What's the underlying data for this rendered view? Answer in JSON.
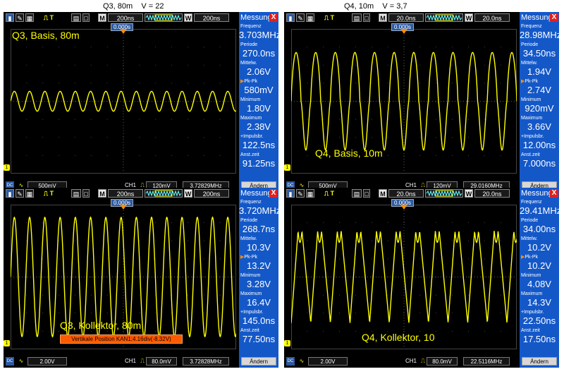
{
  "captions": [
    {
      "text": "Q3, 80m    V = 22"
    },
    {
      "text": "Q4, 10m    V = 3,7"
    }
  ],
  "colors": {
    "trace": "#ffff00",
    "panel": "#1458c8",
    "grid": "#5a5a5a",
    "warning": "#ff5a00"
  },
  "screens": [
    {
      "label": "Q3, Basis, 80m",
      "toolbar": {
        "run_stop": "⎍ T",
        "m": "M",
        "timebase": "200ns",
        "w": "W",
        "window": "200ns"
      },
      "time_marker": "0.000s",
      "panel": {
        "title": "Messung",
        "close": "X",
        "items": [
          {
            "label": "Frequenz",
            "value": "3.703MHz"
          },
          {
            "label": "Periode",
            "value": "270.0ns"
          },
          {
            "label": "Mittelw.",
            "value": "2.06V"
          },
          {
            "label": "Pk-Pk",
            "value": "580mV"
          },
          {
            "label": "Minimum",
            "value": "1.80V"
          },
          {
            "label": "Maximum",
            "value": "2.38V"
          },
          {
            "label": "+Impulsbr.",
            "value": "122.5ns"
          },
          {
            "label": "Anst.zeit",
            "value": "91.25ns"
          }
        ],
        "button": "Ändern"
      },
      "status": {
        "coupling": "DC",
        "volts": "500mV",
        "channel": "CH1",
        "trigger_level": "120mV",
        "freq": "3.72829MHz"
      },
      "trace": {
        "amplitude_divs": 0.55,
        "periods_per_screen": 14.8,
        "offset_divs": 0.0,
        "shape": "sine"
      }
    },
    {
      "label": "Q4, Basis, 10m",
      "toolbar": {
        "run_stop": "⎍ T",
        "m": "M",
        "timebase": "20.0ns",
        "w": "W",
        "window": "20.0ns"
      },
      "time_marker": "0.000s",
      "panel": {
        "title": "Messung",
        "close": "X",
        "items": [
          {
            "label": "Frequenz",
            "value": "28.98MHz"
          },
          {
            "label": "Periode",
            "value": "34.50ns"
          },
          {
            "label": "Mittelw.",
            "value": "1.94V"
          },
          {
            "label": "Pk-Pk",
            "value": "2.74V"
          },
          {
            "label": "Minimum",
            "value": "920mV"
          },
          {
            "label": "Maximum",
            "value": "3.66V"
          },
          {
            "label": "+Impulsbr.",
            "value": "12.00ns"
          },
          {
            "label": "Anst.zeit",
            "value": "7.000ns"
          }
        ],
        "button": "Ändern"
      },
      "status": {
        "coupling": "DC",
        "volts": "500mV",
        "channel": "CH1",
        "trigger_level": "120mV",
        "freq": "29.0160MHz"
      },
      "trace": {
        "amplitude_divs": 2.7,
        "periods_per_screen": 11.5,
        "offset_divs": 0.0,
        "shape": "rounded"
      }
    },
    {
      "label": "Q3, Kollektor, 80m",
      "toolbar": {
        "run_stop": "⎍ T",
        "m": "M",
        "timebase": "200ns",
        "w": "W",
        "window": "200ns"
      },
      "time_marker": "0.000s",
      "warning": "Vertikale  Position  KAN1:4.16div(-8.32V)",
      "panel": {
        "title": "Messung",
        "close": "X",
        "items": [
          {
            "label": "Frequenz",
            "value": "3.720MHz"
          },
          {
            "label": "Periode",
            "value": "268.7ns"
          },
          {
            "label": "Mittelw.",
            "value": "10.3V"
          },
          {
            "label": "Pk-Pk",
            "value": "13.2V"
          },
          {
            "label": "Minimum",
            "value": "3.28V"
          },
          {
            "label": "Maximum",
            "value": "16.4V"
          },
          {
            "label": "+Impulsbr.",
            "value": "145.0ns"
          },
          {
            "label": "Anst.zeit",
            "value": "77.50ns"
          }
        ],
        "button": "Ändern"
      },
      "status": {
        "coupling": "DC",
        "volts": "2.00V",
        "channel": "CH1",
        "trigger_level": "80.0mV",
        "freq": "3.72828MHz"
      },
      "trace": {
        "amplitude_divs": 3.3,
        "periods_per_screen": 14.8,
        "offset_divs": 0.0,
        "shape": "sine"
      }
    },
    {
      "label": "Q4, Kollektor, 10",
      "toolbar": {
        "run_stop": "⎍ T",
        "m": "M",
        "timebase": "20.0ns",
        "w": "W",
        "window": "20.0ns"
      },
      "time_marker": "0.000s",
      "panel": {
        "title": "Messung",
        "close": "X",
        "items": [
          {
            "label": "Frequenz",
            "value": "29.41MHz"
          },
          {
            "label": "Periode",
            "value": "34.00ns"
          },
          {
            "label": "Mittelw.",
            "value": "10.2V"
          },
          {
            "label": "Pk-Pk",
            "value": "10.2V"
          },
          {
            "label": "Minimum",
            "value": "4.08V"
          },
          {
            "label": "Maximum",
            "value": "14.3V"
          },
          {
            "label": "+Impulsbr.",
            "value": "22.50ns"
          },
          {
            "label": "Anst.zeit",
            "value": "17.50ns"
          }
        ],
        "button": "Ändern"
      },
      "status": {
        "coupling": "DC",
        "volts": "2.00V",
        "channel": "CH1",
        "trigger_level": "80.0mV",
        "freq": "22.5116MHz"
      },
      "trace": {
        "amplitude_divs": 2.55,
        "periods_per_screen": 11.5,
        "offset_divs": 0.0,
        "shape": "sawtooth"
      }
    }
  ]
}
